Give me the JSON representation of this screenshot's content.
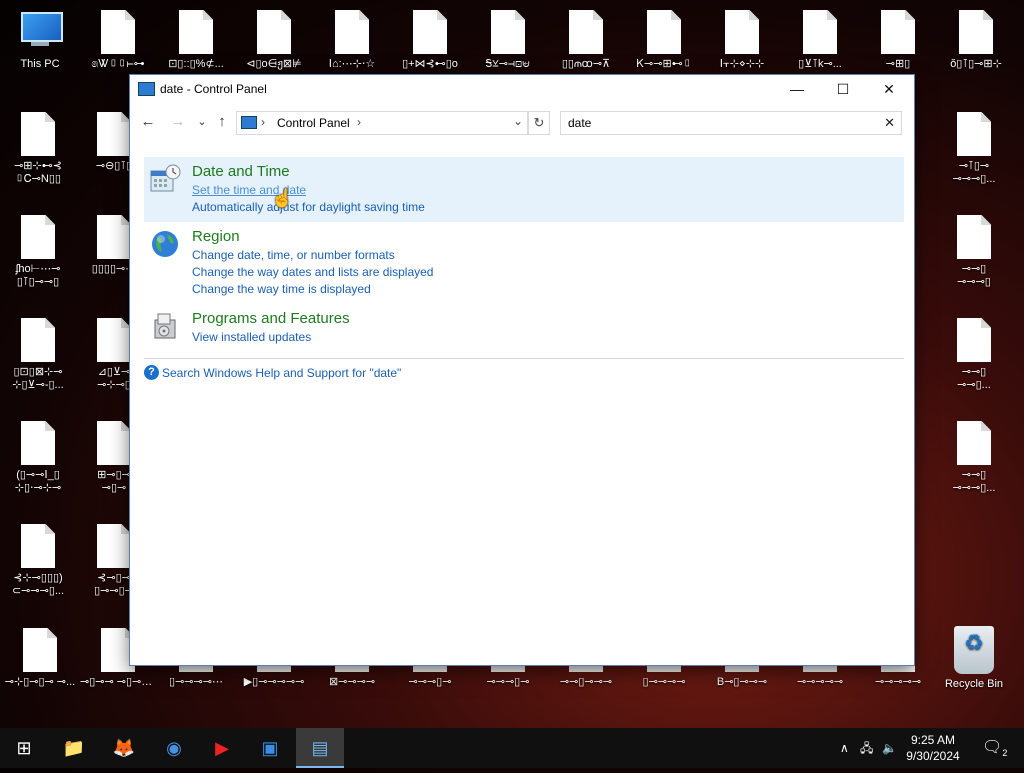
{
  "desktop": {
    "top_row": [
      {
        "label": "This PC",
        "kind": "pc"
      },
      {
        "label": "෧Ꮤ▯▯⊢⊶",
        "kind": "doc"
      },
      {
        "label": "⊡▯::▯%⊄...",
        "kind": "doc"
      },
      {
        "label": "⊲▯o⋳ჟ⊠⊭",
        "kind": "doc"
      },
      {
        "label": "ⵏ⌂:⋯⊹⋅☆",
        "kind": "doc"
      },
      {
        "label": "▯+⋈⊰⊷▯o",
        "kind": "doc"
      },
      {
        "label": "Ꭶ⊻⊸⊣⊡⊌",
        "kind": "doc"
      },
      {
        "label": "▯▯⫙ꝏ⊸⊼",
        "kind": "doc"
      },
      {
        "label": "Ꮶ⊸⊸⊞⊷▯",
        "kind": "doc"
      },
      {
        "label": "ⵏ⫟⊹⋄⊹⊹",
        "kind": "doc"
      },
      {
        "label": "▯⊻⊺k⊸...",
        "kind": "doc"
      },
      {
        "label": "⊸⊞▯",
        "kind": "doc"
      },
      {
        "label": "ŏ▯⊺▯⊸⊞⊹",
        "kind": "doc"
      }
    ],
    "left_cols": [
      {
        "label": "⊸⊞⊹⊷⊰",
        "label2": "▯Ꮯ⊸N▯▯"
      },
      {
        "label": "⊸⊖▯⊺▯",
        "label2": ""
      },
      {
        "label": "ʄho⊢⋯⊸",
        "label2": "▯⊺▯⊸⊸▯"
      },
      {
        "label": "▯▯▯▯⊸⋯",
        "label2": ""
      },
      {
        "label": "▯⊡▯⊠⊹⊸",
        "label2": "⊹▯⊻⊸-▯..."
      },
      {
        "label": "⊿▯⊻⊸",
        "label2": "⊸⊹⊸▯"
      },
      {
        "label": "(▯⊸⊸ⵏ_▯",
        "label2": "⊹▯⋅⊸⊹⊸"
      },
      {
        "label": "⊞⊸▯⊸",
        "label2": "⊸▯⊸"
      },
      {
        "label": "⊰⊹⊸▯▯▯)",
        "label2": "⊂⊸⊸⊸▯..."
      },
      {
        "label": "⊰⊸▯⊸",
        "label2": "▯⊸⊸▯⊸"
      }
    ],
    "right_col": [
      {
        "label": "⊸⊺▯⊸",
        "label2": "⊸⊸⊸▯..."
      },
      {
        "label": "⊸⊸▯",
        "label2": "⊸⊸⊸▯"
      },
      {
        "label": "⊸⊸▯",
        "label2": "⊸⊸▯..."
      },
      {
        "label": "⊸⊸▯",
        "label2": "⊸⊸⊸▯..."
      }
    ],
    "bottom_row": [
      "⊸⊹▯⊸▯⊸ ⊸...",
      "⊸▯⊸⊸ ⊸▯⊸▯...",
      "▯⊸⊸⊸⊸⋯",
      "▶▯⊸⊸⊸⊸⊸",
      "⊠⊸⊸⊸⊸",
      "⊸⊸⊸▯⊸",
      "⊸⊸⊸▯⊸",
      "⊸⊸▯⊸⊸⊸",
      "▯⊸⊸⊸⊸",
      "B⊸▯⊸⊸⊸",
      "⊸⊸⊸⊸⊸",
      "⊸⊸⊸⊸⊸"
    ],
    "recycle_bin": "Recycle Bin"
  },
  "window": {
    "title": "date - Control Panel",
    "controls": {
      "minimize": "—",
      "maximize": "☐",
      "close": "✕"
    },
    "nav": {
      "back": "←",
      "forward": "→",
      "recent": "⌄",
      "up": "↑"
    },
    "address": {
      "crumb": "Control Panel",
      "sep": "›"
    },
    "refresh": "↻",
    "search": {
      "value": "date",
      "clear": "✕"
    },
    "results": [
      {
        "title": "Date and Time",
        "icon": "calendar-clock-icon",
        "links": [
          "Set the time and date",
          "Automatically adjust for daylight saving time"
        ]
      },
      {
        "title": "Region",
        "icon": "globe-icon",
        "links": [
          "Change date, time, or number formats",
          "Change the way dates and lists are displayed",
          "Change the way time is displayed"
        ]
      },
      {
        "title": "Programs and Features",
        "icon": "programs-box-icon",
        "links": [
          "View installed updates"
        ]
      }
    ],
    "help_text": "Search Windows Help and Support for \"date\""
  },
  "taskbar": {
    "start": "⊞",
    "apps": [
      {
        "name": "file-explorer",
        "glyph": "📁"
      },
      {
        "name": "firefox",
        "glyph": "🦊"
      },
      {
        "name": "chrome",
        "glyph": "◉"
      },
      {
        "name": "youtube",
        "glyph": "▶"
      },
      {
        "name": "store-box",
        "glyph": "▣"
      },
      {
        "name": "control-panel",
        "glyph": "▤"
      }
    ],
    "tray": {
      "chevron": "∧",
      "network": "🖧",
      "volume": "🔈"
    },
    "time": "9:25 AM",
    "date": "9/30/2024",
    "notifications": "2"
  },
  "colors": {
    "link": "#1a5fb4",
    "heading": "#1e7a1e",
    "hover_bg": "#e5f1fb"
  }
}
